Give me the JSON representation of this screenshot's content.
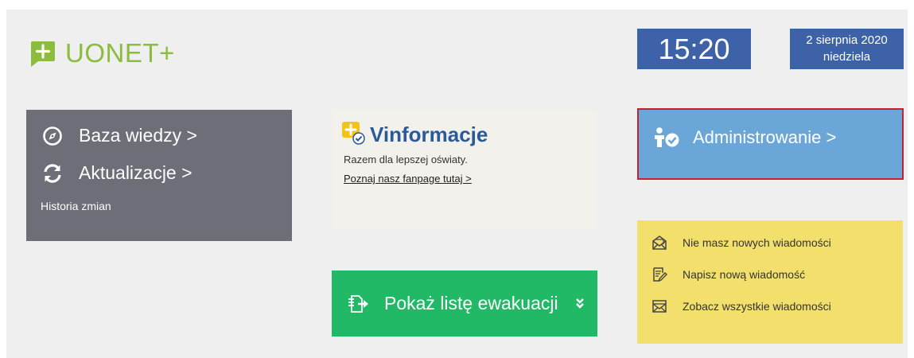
{
  "header": {
    "app_name": "UONET+",
    "time": "15:20",
    "date_line1": "2 sierpnia 2020",
    "date_line2": "niedziela"
  },
  "help_tile": {
    "knowledge_base": "Baza wiedzy >",
    "updates": "Aktualizacje >",
    "history": "Historia zmian"
  },
  "vinformacje": {
    "title": "Vinformacje",
    "tagline": "Razem dla lepszej oświaty.",
    "link": "Poznaj nasz fanpage tutaj >"
  },
  "admin_tile": {
    "label": "Administrowanie >"
  },
  "evacuation_tile": {
    "label": "Pokaż listę ewakuacji"
  },
  "messages_tile": {
    "no_new": "Nie masz nowych wiadomości",
    "write_new": "Napisz nową wiadomość",
    "see_all": "Zobacz wszystkie wiadomości"
  },
  "colors": {
    "brand_green": "#8cbc3c",
    "clock_blue": "#3e62a7",
    "help_gray": "#6d6e78",
    "admin_blue": "#6aa7d8",
    "admin_border": "#c8202e",
    "evac_green": "#22b966",
    "messages_yellow": "#f3e06c"
  }
}
